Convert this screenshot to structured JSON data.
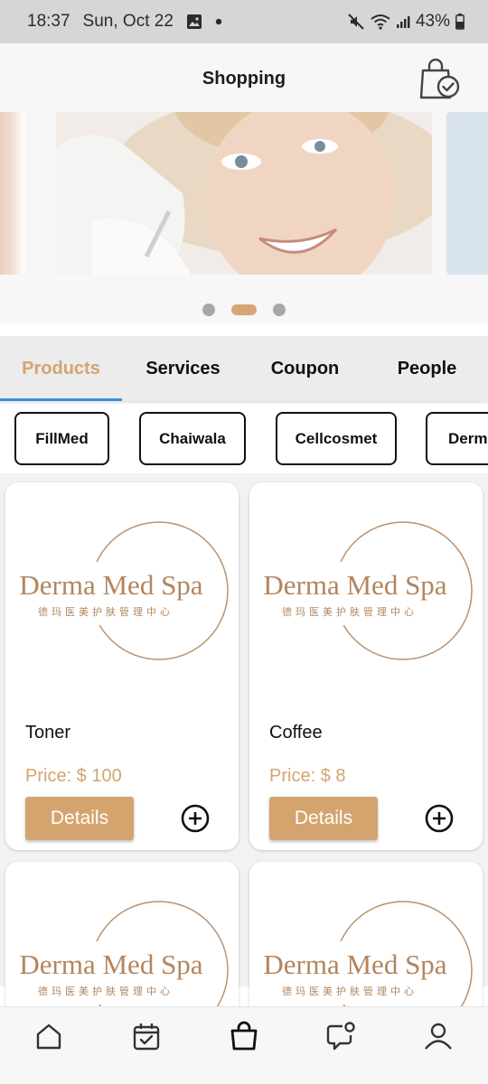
{
  "status_bar": {
    "time": "18:37",
    "date": "Sun, Oct 22",
    "battery": "43%"
  },
  "header": {
    "title": "Shopping"
  },
  "carousel": {
    "slide_count": 3,
    "active_index": 1
  },
  "tabs": [
    {
      "label": "Products",
      "active": true
    },
    {
      "label": "Services",
      "active": false
    },
    {
      "label": "Coupon",
      "active": false
    },
    {
      "label": "People",
      "active": false
    }
  ],
  "brands": [
    "FillMed",
    "Chaiwala",
    "Cellcosmet",
    "Derma"
  ],
  "logo": {
    "name": "Derma Med Spa",
    "subtitle": "德玛医美护肤管理中心"
  },
  "products": [
    {
      "name": "Toner",
      "price": "Price: $ 100",
      "button": "Details"
    },
    {
      "name": "Coffee",
      "price": "Price: $ 8",
      "button": "Details"
    }
  ],
  "colors": {
    "accent": "#d4a46f",
    "tab_indicator": "#3d8fdd"
  },
  "icons": {
    "bottom_nav": [
      "home-icon",
      "calendar-check-icon",
      "shopping-bag-icon",
      "chat-notification-icon",
      "profile-icon"
    ]
  }
}
